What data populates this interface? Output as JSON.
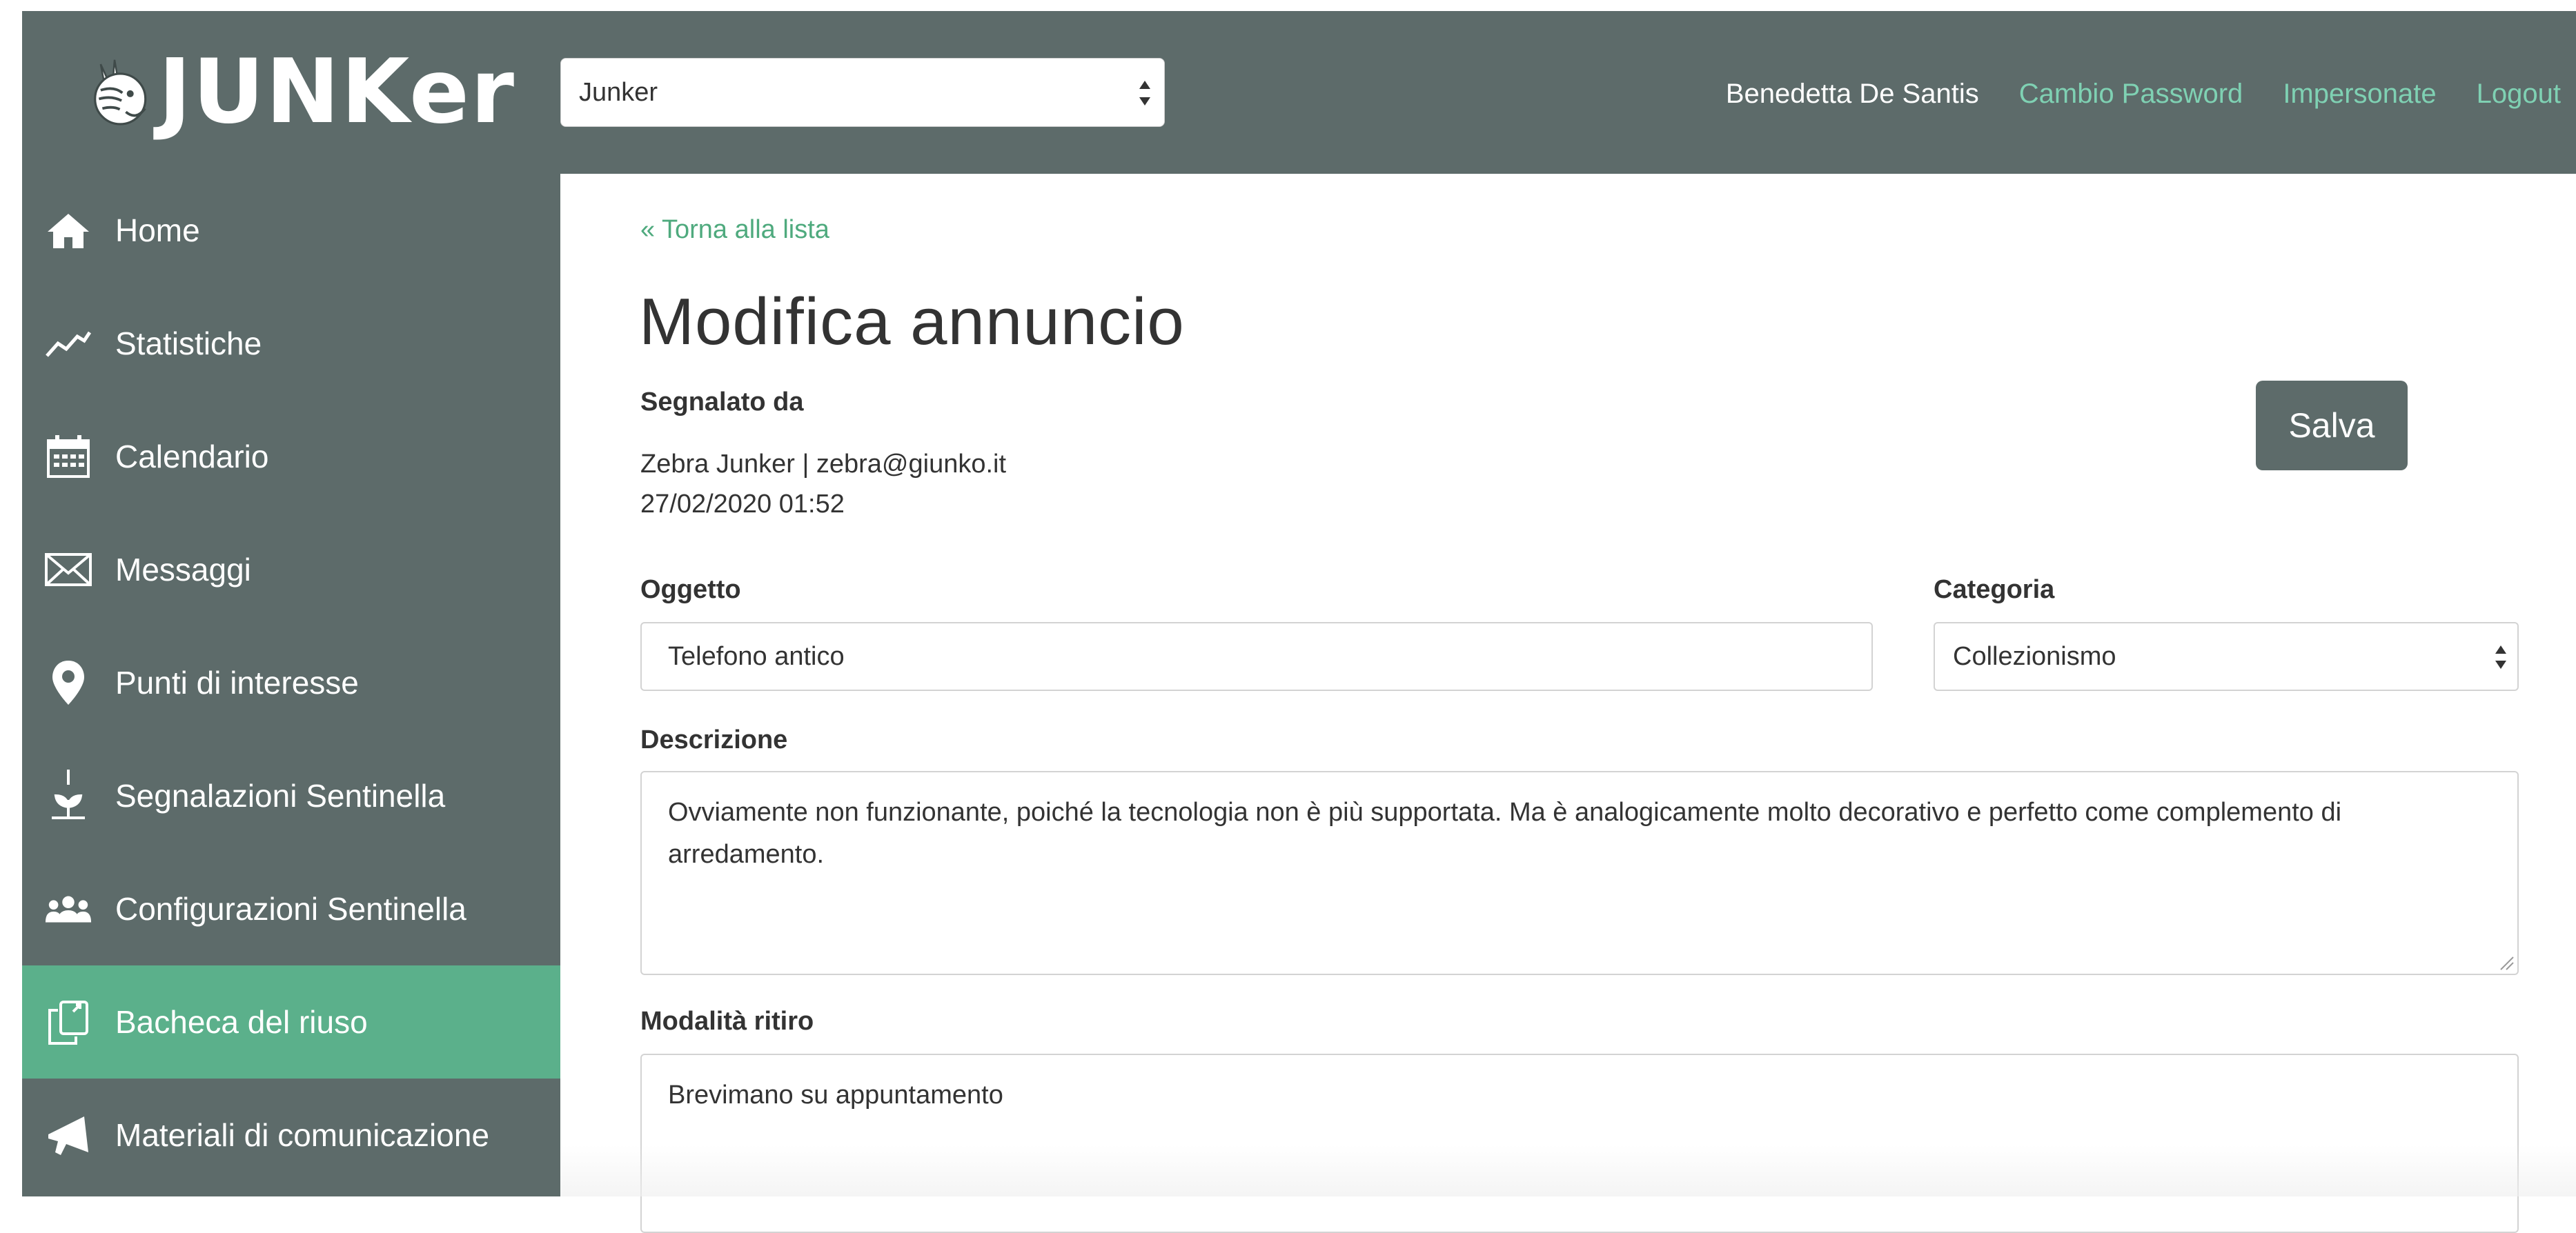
{
  "header": {
    "logo_text": "JUNKer",
    "org_select_value": "Junker",
    "user_name": "Benedetta De Santis",
    "links": [
      "Cambio Password",
      "Impersonate",
      "Logout"
    ]
  },
  "sidebar": {
    "items": [
      {
        "label": "Home",
        "icon": "home-icon"
      },
      {
        "label": "Statistiche",
        "icon": "chart-line-icon"
      },
      {
        "label": "Calendario",
        "icon": "calendar-icon"
      },
      {
        "label": "Messaggi",
        "icon": "envelope-icon"
      },
      {
        "label": "Punti di interesse",
        "icon": "map-pin-icon"
      },
      {
        "label": "Segnalazioni Sentinella",
        "icon": "sprout-icon"
      },
      {
        "label": "Configurazioni Sentinella",
        "icon": "users-icon"
      },
      {
        "label": "Bacheca del riuso",
        "icon": "copy-icon",
        "active": true
      },
      {
        "label": "Materiali di comunicazione",
        "icon": "megaphone-icon"
      }
    ]
  },
  "main": {
    "back_link": "« Torna alla lista",
    "title": "Modifica annuncio",
    "reported_by_label": "Segnalato da",
    "reported_by_value": "Zebra Junker | zebra@giunko.it",
    "reported_date": "27/02/2020 01:52",
    "save_label": "Salva",
    "oggetto_label": "Oggetto",
    "oggetto_value": "Telefono antico",
    "categoria_label": "Categoria",
    "categoria_value": "Collezionismo",
    "descrizione_label": "Descrizione",
    "descrizione_value": "Ovviamente non funzionante, poiché la tecnologia non è più supportata. Ma è analogicamente molto decorativo e perfetto come complemento di arredamento.",
    "ritiro_label": "Modalità ritiro",
    "ritiro_value": "Brevimano su appuntamento"
  },
  "colors": {
    "bar": "#5d6b6a",
    "accent": "#5bb08b",
    "link": "#7fd1b3"
  }
}
